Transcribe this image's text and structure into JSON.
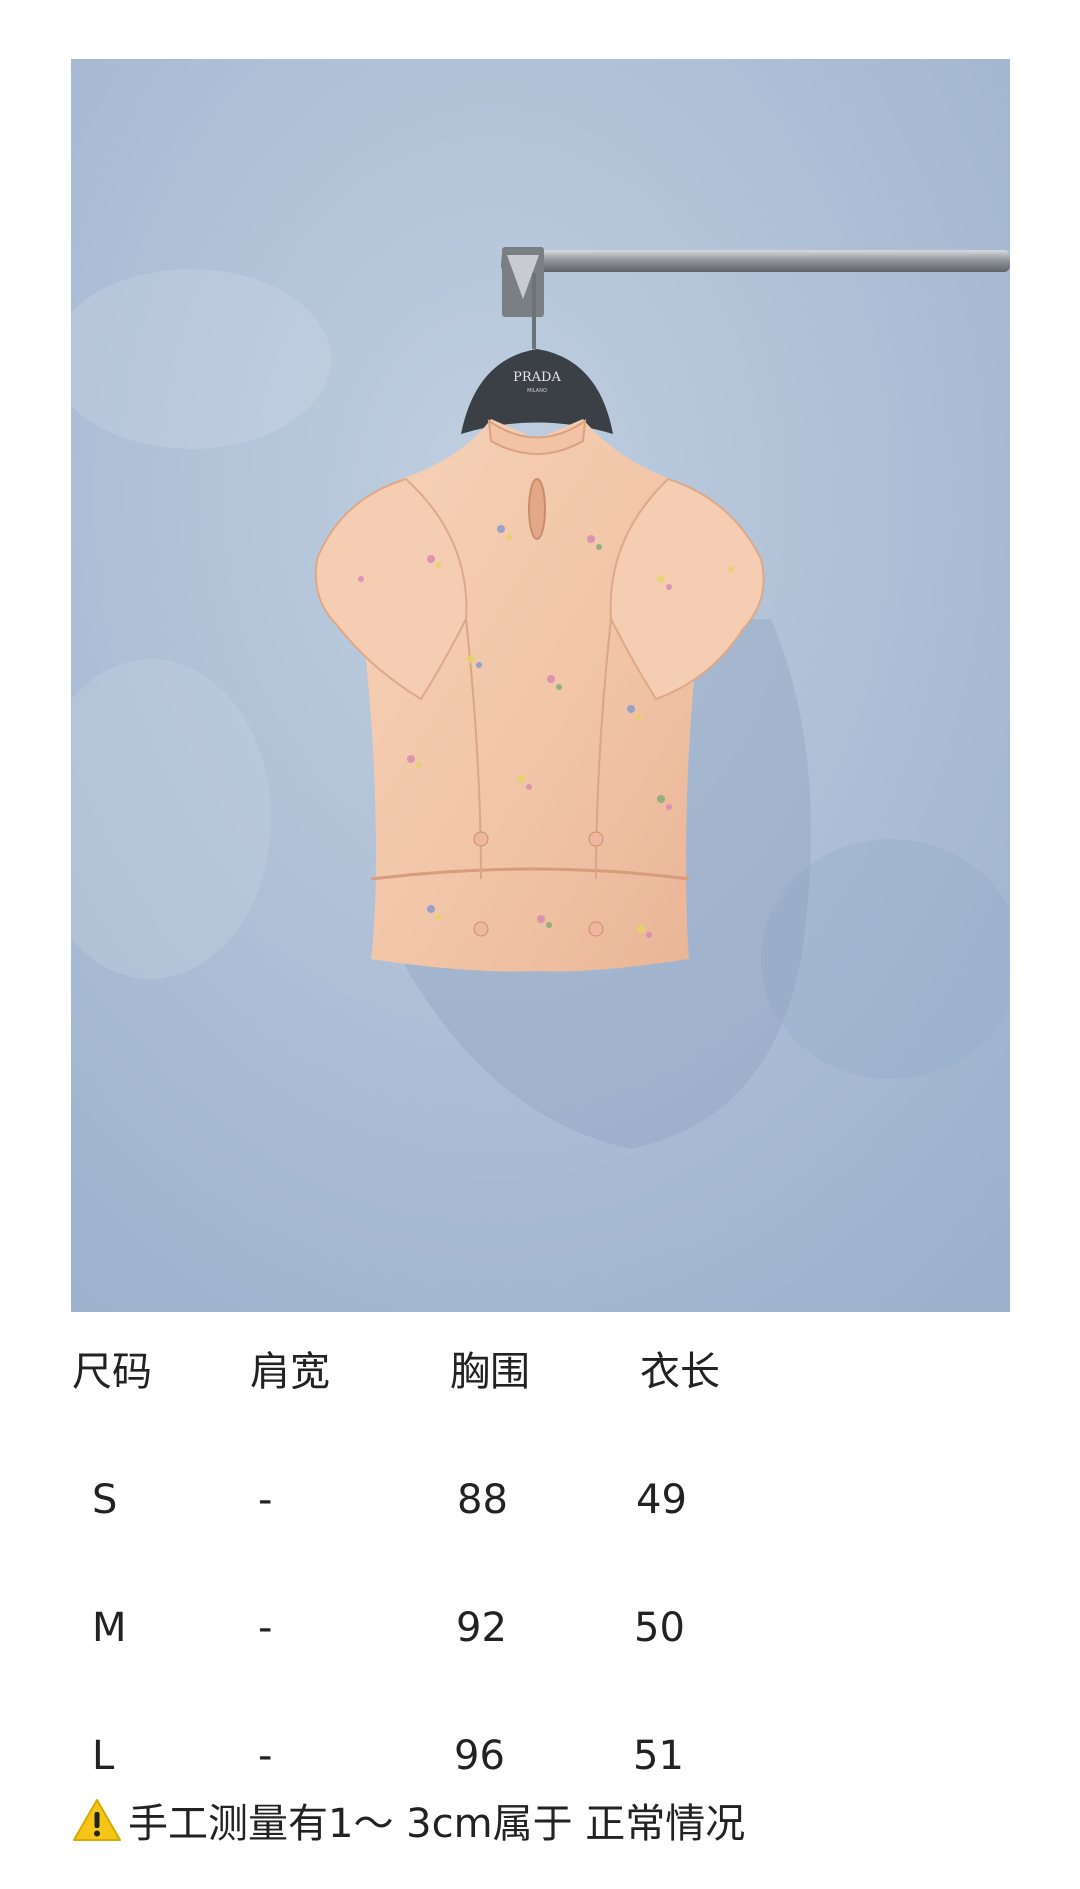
{
  "product": {
    "hanger_brand": "PRADA",
    "hanger_sub": "MILANO"
  },
  "size_table": {
    "headers": [
      "尺码",
      "肩宽",
      "胸围",
      "衣长"
    ],
    "rows": [
      [
        "S",
        "-",
        "88",
        "49"
      ],
      [
        "M",
        "-",
        "92",
        "50"
      ],
      [
        "L",
        "-",
        "96",
        "51"
      ]
    ]
  },
  "note": {
    "icon": "warning-icon",
    "text": "手工测量有1～ 3cm属于 正常情况"
  },
  "colors": {
    "wall": "#a9bbd4",
    "blouse": "#f2c9ad",
    "warning": "#f5c518"
  }
}
